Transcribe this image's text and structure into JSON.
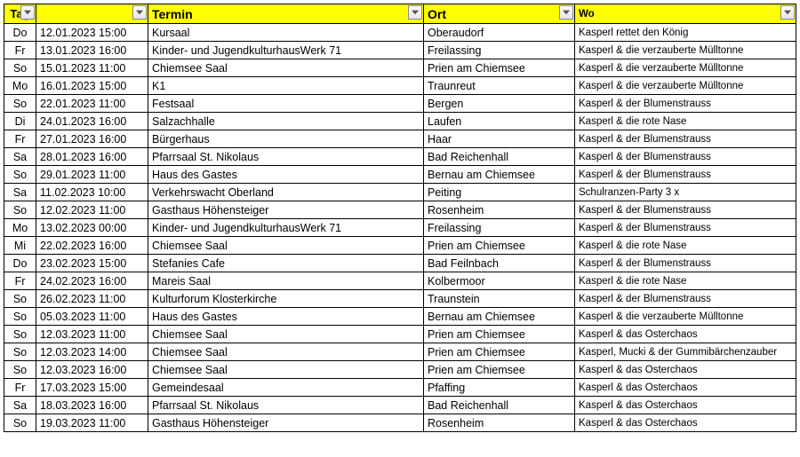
{
  "headers": {
    "tag": "Tag",
    "date": "",
    "termin": "Termin",
    "ort": "Ort",
    "wo": "Wo"
  },
  "rows": [
    {
      "tag": "Do",
      "date": "12.01.2023 15:00",
      "termin": "Kursaal",
      "ort": "Oberaudorf",
      "wo": "Kasperl rettet den König"
    },
    {
      "tag": "Fr",
      "date": "13.01.2023 16:00",
      "termin": "Kinder- und JugendkulturhausWerk 71",
      "ort": "Freilassing",
      "wo": "Kasperl & die verzauberte Mülltonne"
    },
    {
      "tag": "So",
      "date": "15.01.2023 11:00",
      "termin": "Chiemsee Saal",
      "ort": "Prien am Chiemsee",
      "wo": "Kasperl & die verzauberte Mülltonne"
    },
    {
      "tag": "Mo",
      "date": "16.01.2023 15:00",
      "termin": "K1",
      "ort": "Traunreut",
      "wo": "Kasperl & die verzauberte Mülltonne"
    },
    {
      "tag": "So",
      "date": "22.01.2023 11:00",
      "termin": "Festsaal",
      "ort": "Bergen",
      "wo": "Kasperl & der Blumenstrauss"
    },
    {
      "tag": "Di",
      "date": "24.01.2023 16:00",
      "termin": "Salzachhalle",
      "ort": "Laufen",
      "wo": "Kasperl & die rote Nase"
    },
    {
      "tag": "Fr",
      "date": "27.01.2023 16:00",
      "termin": "Bürgerhaus",
      "ort": "Haar",
      "wo": "Kasperl & der Blumenstrauss"
    },
    {
      "tag": "Sa",
      "date": "28.01.2023 16:00",
      "termin": "Pfarrsaal St. Nikolaus",
      "ort": "Bad Reichenhall",
      "wo": "Kasperl & der Blumenstrauss"
    },
    {
      "tag": "So",
      "date": "29.01.2023 11:00",
      "termin": "Haus des Gastes",
      "ort": "Bernau am Chiemsee",
      "wo": "Kasperl & der Blumenstrauss"
    },
    {
      "tag": "Sa",
      "date": "11.02.2023 10:00",
      "termin": "Verkehrswacht Oberland",
      "ort": "Peiting",
      "wo": "Schulranzen-Party 3 x"
    },
    {
      "tag": "So",
      "date": "12.02.2023 11:00",
      "termin": "Gasthaus Höhensteiger",
      "ort": "Rosenheim",
      "wo": "Kasperl & der Blumenstrauss"
    },
    {
      "tag": "Mo",
      "date": "13.02.2023 00:00",
      "termin": "Kinder- und JugendkulturhausWerk 71",
      "ort": "Freilassing",
      "wo": "Kasperl & der Blumenstrauss"
    },
    {
      "tag": "Mi",
      "date": "22.02.2023 16:00",
      "termin": "Chiemsee Saal",
      "ort": "Prien am Chiemsee",
      "wo": "Kasperl & die rote Nase"
    },
    {
      "tag": "Do",
      "date": "23.02.2023 15:00",
      "termin": "Stefanies Cafe",
      "ort": "Bad Feilnbach",
      "wo": "Kasperl & der Blumenstrauss"
    },
    {
      "tag": "Fr",
      "date": "24.02.2023 16:00",
      "termin": "Mareis Saal",
      "ort": "Kolbermoor",
      "wo": "Kasperl & die rote Nase"
    },
    {
      "tag": "So",
      "date": "26.02.2023 11:00",
      "termin": "Kulturforum Klosterkirche",
      "ort": "Traunstein",
      "wo": "Kasperl & der Blumenstrauss"
    },
    {
      "tag": "So",
      "date": "05.03.2023 11:00",
      "termin": "Haus des Gastes",
      "ort": "Bernau am Chiemsee",
      "wo": "Kasperl & die verzauberte Mülltonne"
    },
    {
      "tag": "So",
      "date": "12.03.2023 11:00",
      "termin": "Chiemsee Saal",
      "ort": "Prien am Chiemsee",
      "wo": "Kasperl & das Osterchaos"
    },
    {
      "tag": "So",
      "date": "12.03.2023 14:00",
      "termin": "Chiemsee Saal",
      "ort": "Prien am Chiemsee",
      "wo": "Kasperl, Mucki & der Gummibärchenzauber"
    },
    {
      "tag": "So",
      "date": "12.03.2023 16:00",
      "termin": "Chiemsee Saal",
      "ort": "Prien am Chiemsee",
      "wo": "Kasperl & das Osterchaos"
    },
    {
      "tag": "Fr",
      "date": "17.03.2023 15:00",
      "termin": "Gemeindesaal",
      "ort": "Pfaffing",
      "wo": "Kasperl & das Osterchaos"
    },
    {
      "tag": "Sa",
      "date": "18.03.2023 16:00",
      "termin": "Pfarrsaal St. Nikolaus",
      "ort": "Bad Reichenhall",
      "wo": "Kasperl & das Osterchaos"
    },
    {
      "tag": "So",
      "date": "19.03.2023 11:00",
      "termin": "Gasthaus Höhensteiger",
      "ort": "Rosenheim",
      "wo": "Kasperl & das Osterchaos"
    }
  ]
}
